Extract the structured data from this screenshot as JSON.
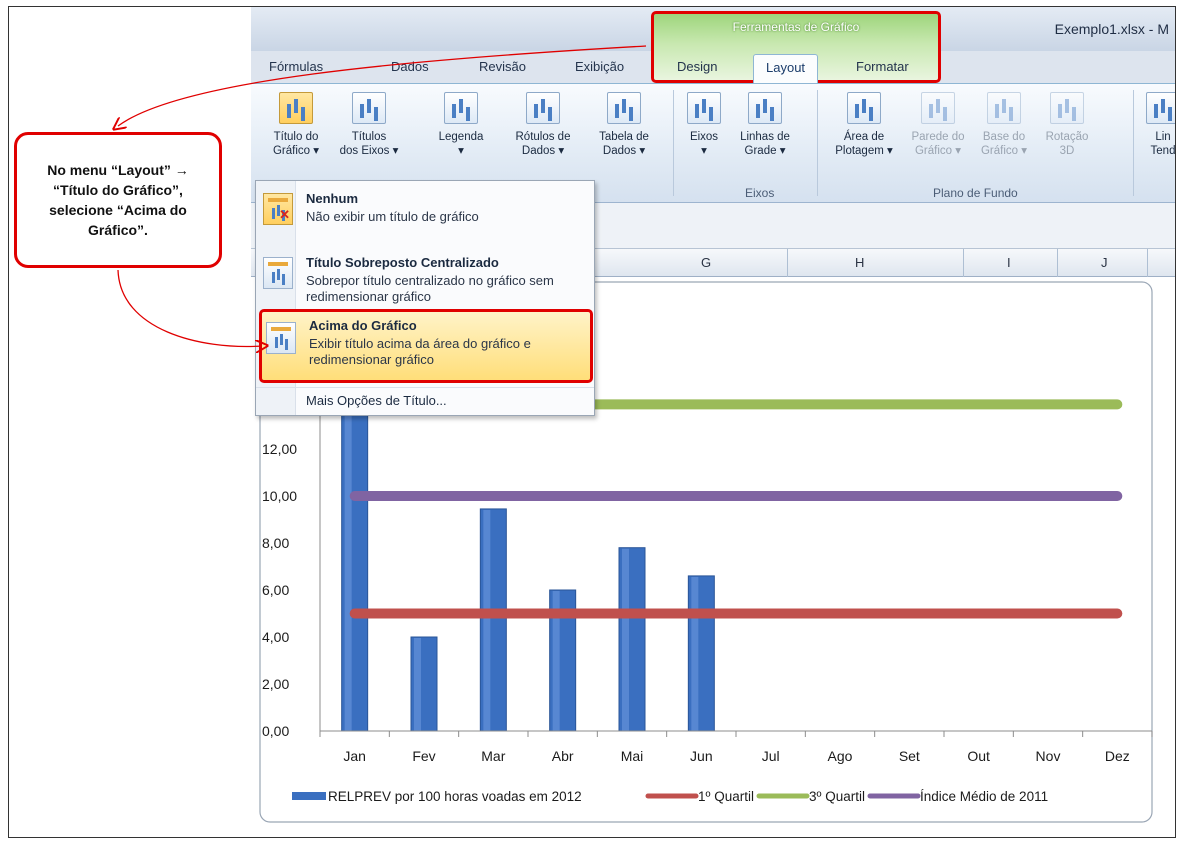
{
  "window": {
    "document_title": "Exemplo1.xlsx - M"
  },
  "chart_tools": {
    "title": "Ferramentas de Gráfico"
  },
  "tabs": [
    {
      "label": "Fórmulas"
    },
    {
      "label": "Dados"
    },
    {
      "label": "Revisão"
    },
    {
      "label": "Exibição"
    },
    {
      "label": "Design"
    },
    {
      "label": "Layout"
    },
    {
      "label": "Formatar"
    }
  ],
  "ribbon": {
    "buttons": [
      {
        "line1": "Título do",
        "line2": "Gráfico ▾"
      },
      {
        "line1": "Títulos",
        "line2": "dos Eixos ▾"
      },
      {
        "line1": "Legenda",
        "line2": "▾"
      },
      {
        "line1": "Rótulos de",
        "line2": "Dados ▾"
      },
      {
        "line1": "Tabela de",
        "line2": "Dados ▾"
      },
      {
        "line1": "Eixos",
        "line2": "▾"
      },
      {
        "line1": "Linhas de",
        "line2": "Grade ▾"
      },
      {
        "line1": "Área de",
        "line2": "Plotagem ▾"
      },
      {
        "line1": "Parede do",
        "line2": "Gráfico ▾"
      },
      {
        "line1": "Base do",
        "line2": "Gráfico ▾"
      },
      {
        "line1": "Rotação",
        "line2": "3D"
      },
      {
        "line1": "Lin",
        "line2": "Tend"
      }
    ],
    "groups": [
      {
        "label": "Eixos"
      },
      {
        "label": "Plano de Fundo"
      }
    ]
  },
  "columns": [
    "G",
    "H",
    "I",
    "J"
  ],
  "menu": {
    "items": [
      {
        "heading": "Nenhum",
        "desc": "Não exibir um título de gráfico"
      },
      {
        "heading": "Título Sobreposto Centralizado",
        "desc": "Sobrepor título centralizado no gráfico sem redimensionar gráfico"
      },
      {
        "heading": "Acima do Gráfico",
        "desc": "Exibir título acima da área do gráfico e redimensionar gráfico"
      }
    ],
    "more": "Mais Opções de Título..."
  },
  "callout": {
    "text": "No menu “Layout” → “Título do Gráfico”, selecione “Acima do Gráfico”."
  },
  "chart_data": {
    "type": "bar",
    "categories": [
      "Jan",
      "Fev",
      "Mar",
      "Abr",
      "Mai",
      "Jun",
      "Jul",
      "Ago",
      "Set",
      "Out",
      "Nov",
      "Dez"
    ],
    "series": [
      {
        "name": "RELPREV por 100 horas voadas em 2012",
        "type": "bar",
        "color": "#3a6fc0",
        "values": [
          13.5,
          4.0,
          9.45,
          6.0,
          7.8,
          6.6,
          null,
          null,
          null,
          null,
          null,
          null
        ]
      },
      {
        "name": "1º Quartil",
        "type": "line",
        "color": "#c0504d",
        "values": [
          5.0,
          5.0,
          5.0,
          5.0,
          5.0,
          5.0,
          5.0,
          5.0,
          5.0,
          5.0,
          5.0,
          5.0
        ]
      },
      {
        "name": "3º Quartil",
        "type": "line",
        "color": "#9bbb59",
        "values": [
          13.9,
          13.9,
          13.9,
          13.9,
          13.9,
          13.9,
          13.9,
          13.9,
          13.9,
          13.9,
          13.9,
          13.9
        ]
      },
      {
        "name": "Índice Médio de 2011",
        "type": "line",
        "color": "#8064a2",
        "values": [
          10.0,
          10.0,
          10.0,
          10.0,
          10.0,
          10.0,
          10.0,
          10.0,
          10.0,
          10.0,
          10.0,
          10.0
        ]
      }
    ],
    "yticks": [
      "0,00",
      "2,00",
      "4,00",
      "6,00",
      "8,00",
      "10,00",
      "12,00"
    ],
    "ylim": [
      0,
      14
    ],
    "legend_position": "bottom"
  }
}
